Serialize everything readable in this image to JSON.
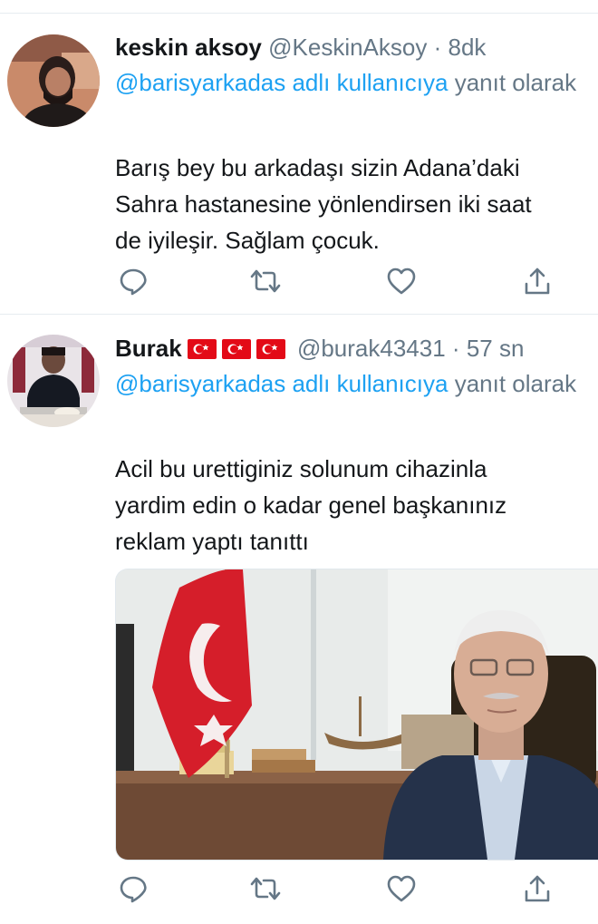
{
  "colors": {
    "link": "#1da1f2",
    "muted": "#657786",
    "text": "#14171a",
    "divider": "#e6ecf0"
  },
  "tweets": [
    {
      "display_name": "keskin aksoy",
      "handle": "@KeskinAksoy",
      "separator": "·",
      "time": "8dk",
      "reply_mention": "@barisyarkadas adlı kullanıcıya",
      "reply_suffix": "yanıt olarak",
      "text": "Barış bey bu arkadaşı sizin Adana’daki\nSahra hastanesine yönlendirsen iki saat\nde iyileşir. Sağlam çocuk.",
      "avatar_icon": "profile-photo"
    },
    {
      "display_name": "Burak",
      "name_flags": [
        "turkey-flag-icon",
        "turkey-flag-icon",
        "turkey-flag-icon"
      ],
      "handle": "@burak43431",
      "separator": "·",
      "time": "57 sn",
      "reply_mention": "@barisyarkadas adlı kullanıcıya",
      "reply_suffix": "yanıt olarak",
      "text": "Acil bu urettiginiz solunum cihazinla\nyardim edin o kadar genel başkanınız\nreklam yaptı tanıttı",
      "avatar_icon": "profile-photo",
      "media": "photo-man-with-turkish-flag"
    }
  ],
  "actions": [
    "reply-icon",
    "retweet-icon",
    "like-icon",
    "share-icon"
  ]
}
